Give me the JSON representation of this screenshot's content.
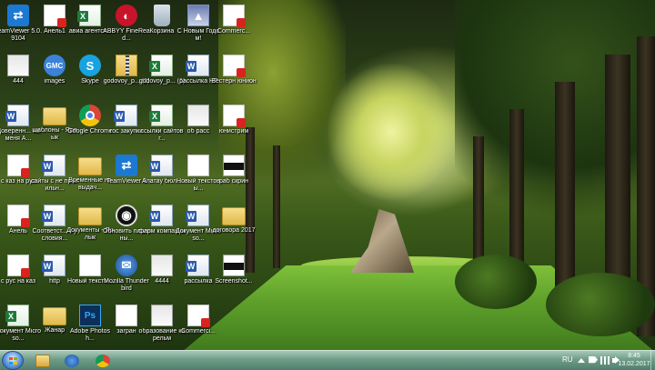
{
  "desktop": {
    "icons": [
      {
        "label": "TeamViewer 5.0.9104",
        "type": "tv",
        "glyph": "⇄",
        "icon_name": "teamviewer-icon"
      },
      {
        "label": "Анель1",
        "type": "pdf",
        "glyph": "",
        "icon_name": "pdf-document-icon"
      },
      {
        "label": "авиа агентст...",
        "type": "excel",
        "glyph": "",
        "icon_name": "excel-document-icon"
      },
      {
        "label": "ABBYY FineRead...",
        "type": "abbyy",
        "glyph": "◐",
        "icon_name": "abbyy-finereader-icon"
      },
      {
        "label": "Корзина",
        "type": "bin",
        "glyph": "",
        "icon_name": "recycle-bin-icon"
      },
      {
        "label": "С Новым Годом!",
        "type": "video",
        "glyph": "▲",
        "icon_name": "video-file-icon"
      },
      {
        "label": "Commerc...",
        "type": "pdf",
        "glyph": "",
        "icon_name": "pdf-document-icon"
      },
      {
        "label": "444",
        "type": "img",
        "glyph": "",
        "icon_name": "image-file-icon"
      },
      {
        "label": "images",
        "type": "images",
        "glyph": "GMC",
        "icon_name": "images-icon"
      },
      {
        "label": "Skype",
        "type": "skype",
        "glyph": "S",
        "icon_name": "skype-icon"
      },
      {
        "label": "godovoy_p... (1)",
        "type": "zip",
        "glyph": "",
        "icon_name": "archive-file-icon"
      },
      {
        "label": "godovoy_p... (1)",
        "type": "excel",
        "glyph": "",
        "icon_name": "excel-document-icon"
      },
      {
        "label": "рассылка НГ",
        "type": "word",
        "glyph": "",
        "icon_name": "word-document-icon"
      },
      {
        "label": "Вестерн юнион",
        "type": "pdf",
        "glyph": "",
        "icon_name": "pdf-document-icon"
      },
      {
        "label": "Доверенн... на меня А...",
        "type": "word",
        "glyph": "",
        "icon_name": "word-document-icon"
      },
      {
        "label": "шаблоны - Ярлык",
        "type": "folder",
        "glyph": "",
        "icon_name": "folder-shortcut-icon"
      },
      {
        "label": "Google Chrome",
        "type": "chrome",
        "glyph": "",
        "icon_name": "chrome-icon"
      },
      {
        "label": "гос закупки",
        "type": "word",
        "glyph": "",
        "icon_name": "word-document-icon"
      },
      {
        "label": "ссылки сайтов г...",
        "type": "excel",
        "glyph": "",
        "icon_name": "excel-document-icon"
      },
      {
        "label": "об расс",
        "type": "img",
        "glyph": "",
        "icon_name": "image-file-icon"
      },
      {
        "label": "юнистрим",
        "type": "pdf",
        "glyph": "",
        "icon_name": "pdf-document-icon"
      },
      {
        "label": "с каз на рус",
        "type": "pdf",
        "glyph": "",
        "icon_name": "pdf-document-icon"
      },
      {
        "label": "сайты с не правильн...",
        "type": "word",
        "glyph": "",
        "icon_name": "word-document-icon"
      },
      {
        "label": "Временные на выдач...",
        "type": "folder",
        "glyph": "",
        "icon_name": "folder-shortcut-icon"
      },
      {
        "label": "TeamViewer 9",
        "type": "tv",
        "glyph": "⇄",
        "icon_name": "teamviewer-icon"
      },
      {
        "label": "Алатау бюл...",
        "type": "word",
        "glyph": "",
        "icon_name": "word-document-icon"
      },
      {
        "label": "Новый текстовы...",
        "type": "doc",
        "glyph": "",
        "icon_name": "text-document-icon"
      },
      {
        "label": "раб скрин",
        "type": "shot",
        "glyph": "",
        "icon_name": "screenshot-file-icon"
      },
      {
        "label": "Анель",
        "type": "pdf",
        "glyph": "",
        "icon_name": "pdf-document-icon"
      },
      {
        "label": "Соответст... с условия...",
        "type": "word",
        "glyph": "",
        "icon_name": "word-document-icon"
      },
      {
        "label": "Документы - Ярлык",
        "type": "folder",
        "glyph": "",
        "icon_name": "folder-shortcut-icon"
      },
      {
        "label": "Обновить плагины...",
        "type": "obs",
        "glyph": "◉",
        "icon_name": "update-plugins-icon"
      },
      {
        "label": "фарм компании",
        "type": "word",
        "glyph": "",
        "icon_name": "word-document-icon"
      },
      {
        "label": "Документ Microso...",
        "type": "word",
        "glyph": "",
        "icon_name": "word-document-icon"
      },
      {
        "label": "договора 2017",
        "type": "folder",
        "glyph": "",
        "icon_name": "folder-icon"
      },
      {
        "label": "с рус на каз",
        "type": "pdf",
        "glyph": "",
        "icon_name": "pdf-document-icon"
      },
      {
        "label": "http",
        "type": "word",
        "glyph": "",
        "icon_name": "word-document-icon"
      },
      {
        "label": "Новый тексто...",
        "type": "doc",
        "glyph": "",
        "icon_name": "text-document-icon"
      },
      {
        "label": "Mozilla Thunderbird",
        "type": "thunder",
        "glyph": "✉",
        "icon_name": "thunderbird-icon"
      },
      {
        "label": "4444",
        "type": "img",
        "glyph": "",
        "icon_name": "image-file-icon"
      },
      {
        "label": "рассылка",
        "type": "word",
        "glyph": "",
        "icon_name": "word-document-icon"
      },
      {
        "label": "Screenshot...",
        "type": "shot",
        "glyph": "",
        "icon_name": "screenshot-file-icon"
      },
      {
        "label": "Документ Microso...",
        "type": "excel",
        "glyph": "",
        "icon_name": "excel-document-icon"
      },
      {
        "label": "Жанар",
        "type": "folder",
        "glyph": "",
        "icon_name": "folder-icon"
      },
      {
        "label": "Adobe Photosh...",
        "type": "ps",
        "glyph": "Ps",
        "icon_name": "photoshop-icon"
      },
      {
        "label": "загран",
        "type": "doc",
        "glyph": "",
        "icon_name": "document-file-icon"
      },
      {
        "label": "образование карельм",
        "type": "img",
        "glyph": "",
        "icon_name": "image-file-icon"
      },
      {
        "label": "Commerci...",
        "type": "pdf",
        "glyph": "",
        "icon_name": "pdf-document-icon"
      }
    ]
  },
  "taskbar": {
    "pinned": [
      {
        "name": "explorer",
        "icon_name": "explorer-icon"
      },
      {
        "name": "thunderbird",
        "icon_name": "thunderbird-icon"
      },
      {
        "name": "chrome",
        "icon_name": "chrome-icon"
      }
    ],
    "tray": {
      "language": "RU",
      "time": "8:45",
      "date": "13.02.2017"
    }
  }
}
